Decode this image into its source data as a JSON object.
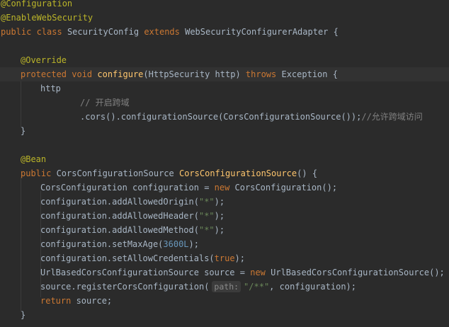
{
  "code_lines": [
    {
      "indent": 0,
      "tokens": [
        {
          "text": "@Configuration",
          "kind": "annotation"
        }
      ]
    },
    {
      "indent": 0,
      "tokens": [
        {
          "text": "@EnableWebSecurity",
          "kind": "annotation"
        }
      ]
    },
    {
      "indent": 0,
      "tokens": [
        {
          "text": "public ",
          "kind": "keyword"
        },
        {
          "text": "class ",
          "kind": "keyword"
        },
        {
          "text": "SecurityConfig ",
          "kind": "text"
        },
        {
          "text": "extends ",
          "kind": "keyword"
        },
        {
          "text": "WebSecurityConfigurerAdapter {",
          "kind": "text"
        }
      ]
    },
    {
      "indent": 0,
      "tokens": []
    },
    {
      "indent": 4,
      "tokens": [
        {
          "text": "@Override",
          "kind": "annotation"
        }
      ]
    },
    {
      "indent": 4,
      "current": true,
      "tokens": [
        {
          "text": "protected ",
          "kind": "keyword"
        },
        {
          "text": "void ",
          "kind": "keyword"
        },
        {
          "text": "configure",
          "kind": "function"
        },
        {
          "text": "(HttpSecurity http) ",
          "kind": "text"
        },
        {
          "text": "throws ",
          "kind": "keyword"
        },
        {
          "text": "Exception {",
          "kind": "text"
        }
      ]
    },
    {
      "indent": 8,
      "tokens": [
        {
          "text": "http",
          "kind": "text"
        }
      ]
    },
    {
      "indent": 16,
      "tokens": [
        {
          "text": "// 开启跨域",
          "kind": "comment"
        }
      ]
    },
    {
      "indent": 16,
      "tokens": [
        {
          "text": ".cors().configurationSource(CorsConfigurationSource());",
          "kind": "text"
        },
        {
          "text": "//允许跨域访问",
          "kind": "comment"
        }
      ]
    },
    {
      "indent": 4,
      "tokens": [
        {
          "text": "}",
          "kind": "text"
        }
      ]
    },
    {
      "indent": 0,
      "tokens": []
    },
    {
      "indent": 4,
      "tokens": [
        {
          "text": "@Bean",
          "kind": "annotation"
        }
      ]
    },
    {
      "indent": 4,
      "tokens": [
        {
          "text": "public ",
          "kind": "keyword"
        },
        {
          "text": "CorsConfigurationSource ",
          "kind": "text"
        },
        {
          "text": "CorsConfigurationSource",
          "kind": "function"
        },
        {
          "text": "() {",
          "kind": "text"
        }
      ]
    },
    {
      "indent": 8,
      "tokens": [
        {
          "text": "CorsConfiguration configuration = ",
          "kind": "text"
        },
        {
          "text": "new ",
          "kind": "keyword"
        },
        {
          "text": "CorsConfiguration();",
          "kind": "text"
        }
      ]
    },
    {
      "indent": 8,
      "tokens": [
        {
          "text": "configuration.addAllowedOrigin(",
          "kind": "text"
        },
        {
          "text": "\"*\"",
          "kind": "string"
        },
        {
          "text": ");",
          "kind": "text"
        }
      ]
    },
    {
      "indent": 8,
      "tokens": [
        {
          "text": "configuration.addAllowedHeader(",
          "kind": "text"
        },
        {
          "text": "\"*\"",
          "kind": "string"
        },
        {
          "text": ");",
          "kind": "text"
        }
      ]
    },
    {
      "indent": 8,
      "tokens": [
        {
          "text": "configuration.addAllowedMethod(",
          "kind": "text"
        },
        {
          "text": "\"*\"",
          "kind": "string"
        },
        {
          "text": ");",
          "kind": "text"
        }
      ]
    },
    {
      "indent": 8,
      "tokens": [
        {
          "text": "configuration.setMaxAge(",
          "kind": "text"
        },
        {
          "text": "3600L",
          "kind": "number"
        },
        {
          "text": ");",
          "kind": "text"
        }
      ]
    },
    {
      "indent": 8,
      "tokens": [
        {
          "text": "configuration.setAllowCredentials(",
          "kind": "text"
        },
        {
          "text": "true",
          "kind": "keyword"
        },
        {
          "text": ");",
          "kind": "text"
        }
      ]
    },
    {
      "indent": 8,
      "tokens": [
        {
          "text": "UrlBasedCorsConfigurationSource source = ",
          "kind": "text"
        },
        {
          "text": "new ",
          "kind": "keyword"
        },
        {
          "text": "UrlBasedCorsConfigurationSource();",
          "kind": "text"
        }
      ]
    },
    {
      "indent": 8,
      "tokens": [
        {
          "text": "source.registerCorsConfiguration(",
          "kind": "text"
        },
        {
          "text": "path:",
          "kind": "hint"
        },
        {
          "text": "\"/**\"",
          "kind": "string"
        },
        {
          "text": ", configuration);",
          "kind": "text"
        }
      ]
    },
    {
      "indent": 8,
      "tokens": [
        {
          "text": "return ",
          "kind": "keyword"
        },
        {
          "text": "source;",
          "kind": "text"
        }
      ]
    },
    {
      "indent": 4,
      "tokens": [
        {
          "text": "}",
          "kind": "text"
        }
      ]
    }
  ],
  "colors": {
    "background": "#2b2b2b",
    "current_line": "#323232",
    "text": "#a9b7c6",
    "keyword": "#cc7832",
    "annotation": "#bbb529",
    "function": "#ffc66d",
    "string": "#6a8759",
    "number": "#6897bb",
    "comment": "#808080"
  }
}
